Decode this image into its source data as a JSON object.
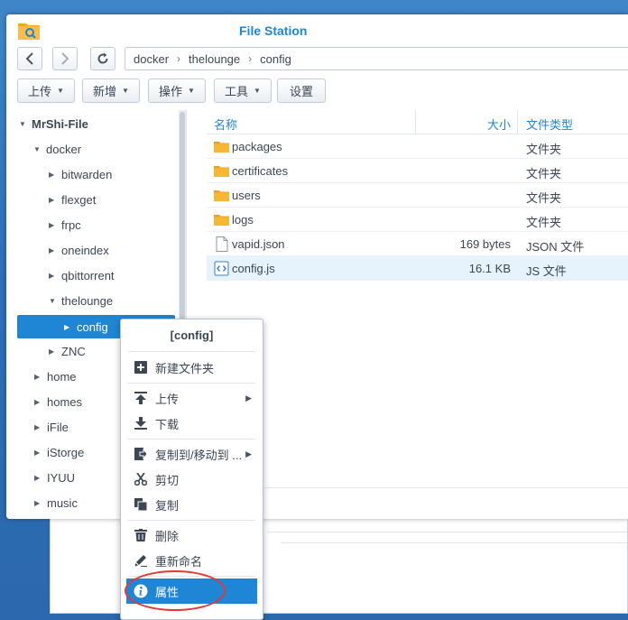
{
  "window": {
    "title": "File Station"
  },
  "nav": {
    "back_icon": "chevron-left-icon",
    "forward_icon": "chevron-right-icon",
    "refresh_icon": "refresh-icon",
    "path": [
      "docker",
      "thelounge",
      "config"
    ]
  },
  "toolbar": {
    "upload": "上传",
    "new": "新增",
    "action": "操作",
    "tools": "工具",
    "settings": "设置"
  },
  "sidebar": {
    "root": "MrShi-File",
    "items": [
      {
        "label": "docker",
        "level": 1,
        "expanded": true
      },
      {
        "label": "bitwarden",
        "level": 2
      },
      {
        "label": "flexget",
        "level": 2
      },
      {
        "label": "frpc",
        "level": 2
      },
      {
        "label": "oneindex",
        "level": 2
      },
      {
        "label": "qbittorrent",
        "level": 2
      },
      {
        "label": "thelounge",
        "level": 2,
        "expanded": true
      },
      {
        "label": "config",
        "level": 3,
        "selected": true
      },
      {
        "label": "ZNC",
        "level": 2
      },
      {
        "label": "home",
        "level": 1
      },
      {
        "label": "homes",
        "level": 1
      },
      {
        "label": "iFile",
        "level": 1
      },
      {
        "label": "iStorge",
        "level": 1
      },
      {
        "label": "IYUU",
        "level": 1
      },
      {
        "label": "music",
        "level": 1
      }
    ]
  },
  "filelist": {
    "columns": {
      "name": "名称",
      "size": "大小",
      "type": "文件类型"
    },
    "rows": [
      {
        "name": "packages",
        "size": "",
        "type": "文件夹",
        "icon": "folder-icon"
      },
      {
        "name": "certificates",
        "size": "",
        "type": "文件夹",
        "icon": "folder-icon"
      },
      {
        "name": "users",
        "size": "",
        "type": "文件夹",
        "icon": "folder-icon"
      },
      {
        "name": "logs",
        "size": "",
        "type": "文件夹",
        "icon": "folder-icon"
      },
      {
        "name": "vapid.json",
        "size": "169 bytes",
        "type": "JSON 文件",
        "icon": "file-icon"
      },
      {
        "name": "config.js",
        "size": "16.1 KB",
        "type": "JS 文件",
        "icon": "code-file-icon",
        "selected": true
      }
    ]
  },
  "context_menu": {
    "title": "[config]",
    "items": {
      "new_folder": "新建文件夹",
      "upload": "上传",
      "download": "下载",
      "copy_move": "复制到/移动到 ...",
      "cut": "剪切",
      "copy": "复制",
      "delete": "删除",
      "rename": "重新命名",
      "properties": "属性"
    }
  },
  "colors": {
    "accent": "#1f86d6",
    "folder": "#f5a623",
    "highlight_ring": "#e53935"
  }
}
